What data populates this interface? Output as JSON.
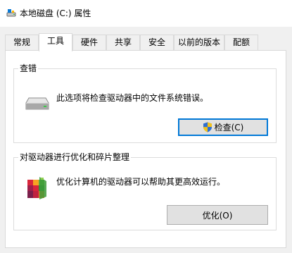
{
  "window": {
    "title": "本地磁盘 (C:) 属性",
    "icon": "drive-icon"
  },
  "tabs": [
    {
      "label": "常规",
      "active": false
    },
    {
      "label": "工具",
      "active": true
    },
    {
      "label": "硬件",
      "active": false
    },
    {
      "label": "共享",
      "active": false
    },
    {
      "label": "安全",
      "active": false
    },
    {
      "label": "以前的版本",
      "active": false
    },
    {
      "label": "配额",
      "active": false
    }
  ],
  "error_checking": {
    "title": "查错",
    "description": "此选项将检查驱动器中的文件系统错误。",
    "button_label": "检查(C)",
    "icon": "hard-drive-icon",
    "button_icon": "uac-shield-icon"
  },
  "optimize": {
    "title": "对驱动器进行优化和碎片整理",
    "description": "优化计算机的驱动器可以帮助其更高效运行。",
    "button_label": "优化(O)",
    "icon": "defrag-icon"
  },
  "colors": {
    "accent": "#0078d7",
    "background": "#f0f0f0"
  }
}
